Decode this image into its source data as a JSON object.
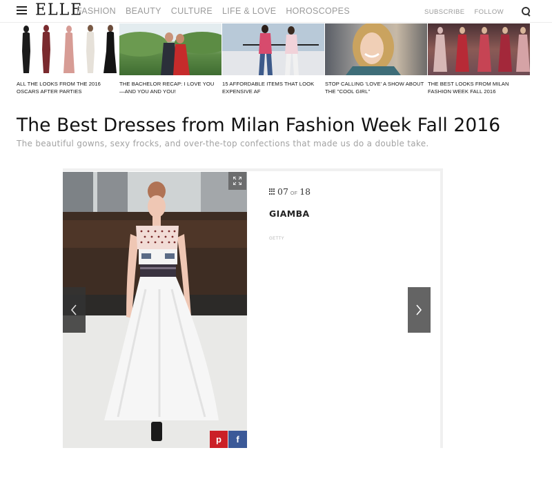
{
  "brand": {
    "logo": "ELLE"
  },
  "nav": {
    "links": [
      "FASHION",
      "BEAUTY",
      "CULTURE",
      "LIFE & LOVE",
      "HOROSCOPES"
    ],
    "subscribe": "SUBSCRIBE",
    "follow": "FOLLOW"
  },
  "related": [
    {
      "title": "ALL THE LOOKS FROM THE 2016 OSCARS AFTER PARTIES"
    },
    {
      "title": "THE BACHELOR RECAP: I LOVE YOU—AND YOU AND YOU!"
    },
    {
      "title": "15 AFFORDABLE ITEMS THAT LOOK EXPENSIVE AF"
    },
    {
      "title": "STOP CALLING 'LOVE' A SHOW ABOUT THE \"COOL GIRL\""
    },
    {
      "title": "THE BEST LOOKS FROM MILAN FASHION WEEK FALL 2016"
    }
  ],
  "article": {
    "headline": "The Best Dresses from Milan Fashion Week Fall 2016",
    "dek": "The beautiful gowns, sexy frocks, and over-the-top confections that made us do a double take."
  },
  "slideshow": {
    "current": "07",
    "of_label": "OF",
    "total": "18",
    "slide_title": "GIAMBA",
    "credit": "GETTY",
    "share": {
      "pinterest": "p",
      "facebook": "f"
    }
  },
  "colors": {
    "pinterest": "#cb2027",
    "facebook": "#3b5998",
    "nav_text": "#9a9a9a",
    "dek_text": "#a2a2a2"
  }
}
